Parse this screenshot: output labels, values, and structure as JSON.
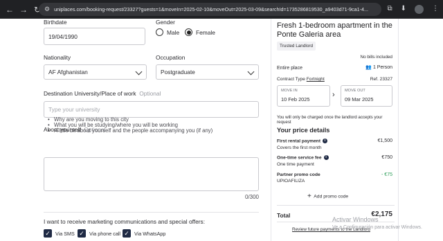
{
  "browser": {
    "url": "uniplaces.com/booking-request/23327?guests=1&moveIn=2025-02-10&moveOut=2025-03-09&searchId=1735286819530_a9403d71-9ca1-4..."
  },
  "form": {
    "birthdate": {
      "label": "Birthdate",
      "value": "19/04/1990"
    },
    "gender": {
      "label": "Gender",
      "options": [
        {
          "label": "Male",
          "selected": false
        },
        {
          "label": "Female",
          "selected": true
        }
      ]
    },
    "nationality": {
      "label": "Nationality",
      "value": "AF Afghanistan"
    },
    "occupation": {
      "label": "Occupation",
      "value": "Postgraduate"
    },
    "university": {
      "label": "Destination University/Place of work",
      "optional": "Optional",
      "placeholder": "Type your university"
    },
    "about": {
      "label": "About yourself",
      "optional": "Optional",
      "hints": [
        "Why are you moving to this city",
        "What you will be studying/where you will be working",
        "A little bit about yourself and the people accompanying you (if any)"
      ],
      "counter": "0/300"
    },
    "marketing": {
      "label": "I want to receive marketing communications and special offers:",
      "options": [
        "Via SMS",
        "Via phone call",
        "Via WhatsApp"
      ]
    }
  },
  "summary": {
    "title": "Fresh 1-bedroom apartment in the Ponte Galeria area",
    "landlord_badge": "Trusted Landlord",
    "bills": "No bills included",
    "entire_place": "Entire place",
    "persons": "1 Person",
    "contract_type_label": "Contract Type",
    "contract_type_value": "Fortnight",
    "ref": "Ref. 23327",
    "move_in_label": "MOVE IN",
    "move_in_value": "10 Feb 2025",
    "move_out_label": "MOVE OUT",
    "move_out_value": "09 Mar 2025",
    "charge_note": "You will only be charged once the landlord accepts your request",
    "price_title": "Your price details",
    "first_rental_label": "First rental payment",
    "first_rental_sub": "Covers the first month",
    "first_rental_value": "€1,500",
    "service_fee_label": "One-time service fee",
    "service_fee_sub": "One time payment",
    "service_fee_value": "€750",
    "promo_label": "Partner promo code",
    "promo_code": "UPIOAFILIZA",
    "promo_value": "- €75",
    "add_promo": "Add promo code",
    "total_label": "Total",
    "total_value": "€2,175",
    "review_link": "Review future payments to the Landlord"
  },
  "watermark": {
    "line1": "Activar Windows",
    "line2": "Ve a Configuración para activar Windows."
  },
  "colors": {
    "primary": "#1f2a44",
    "border": "#c9c9ce",
    "promo_green": "#2e9e5b"
  }
}
